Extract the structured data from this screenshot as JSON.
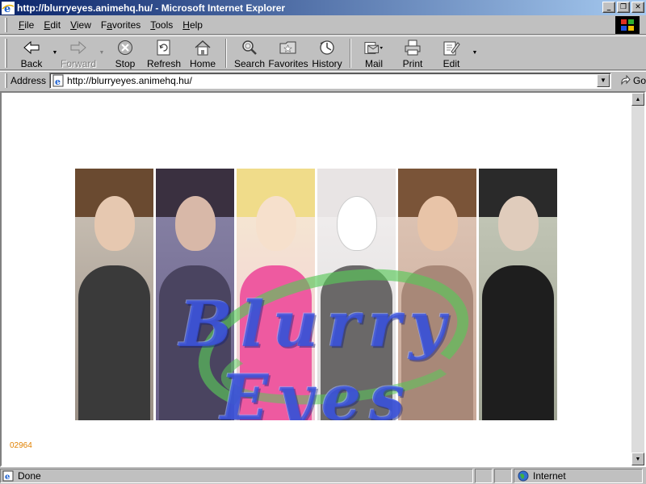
{
  "window": {
    "title": "http://blurryeyes.animehq.hu/ - Microsoft Internet Explorer",
    "minimize_glyph": "_",
    "maximize_glyph": "❐",
    "close_glyph": "✕"
  },
  "menu": {
    "items": [
      {
        "label": "File",
        "accel": "F"
      },
      {
        "label": "Edit",
        "accel": "E"
      },
      {
        "label": "View",
        "accel": "V"
      },
      {
        "label": "Favorites",
        "accel": "a"
      },
      {
        "label": "Tools",
        "accel": "T"
      },
      {
        "label": "Help",
        "accel": "H"
      }
    ]
  },
  "toolbar": {
    "back": "Back",
    "forward": "Forward",
    "stop": "Stop",
    "refresh": "Refresh",
    "home": "Home",
    "search": "Search",
    "favorites": "Favorites",
    "history": "History",
    "mail": "Mail",
    "print": "Print",
    "edit": "Edit"
  },
  "address": {
    "label": "Address",
    "url": "http://blurryeyes.animehq.hu/",
    "go": "Go"
  },
  "page": {
    "banner_title": "Blurry Eyes",
    "counter": "02964"
  },
  "status": {
    "text": "Done",
    "zone": "Internet"
  },
  "colors": {
    "title_gradient_start": "#0a246a",
    "title_gradient_end": "#a6caf0",
    "chrome": "#c0c0c0",
    "counter": "#e08000",
    "banner_text": "#3750dc",
    "swoosh": "#5ac85a"
  }
}
